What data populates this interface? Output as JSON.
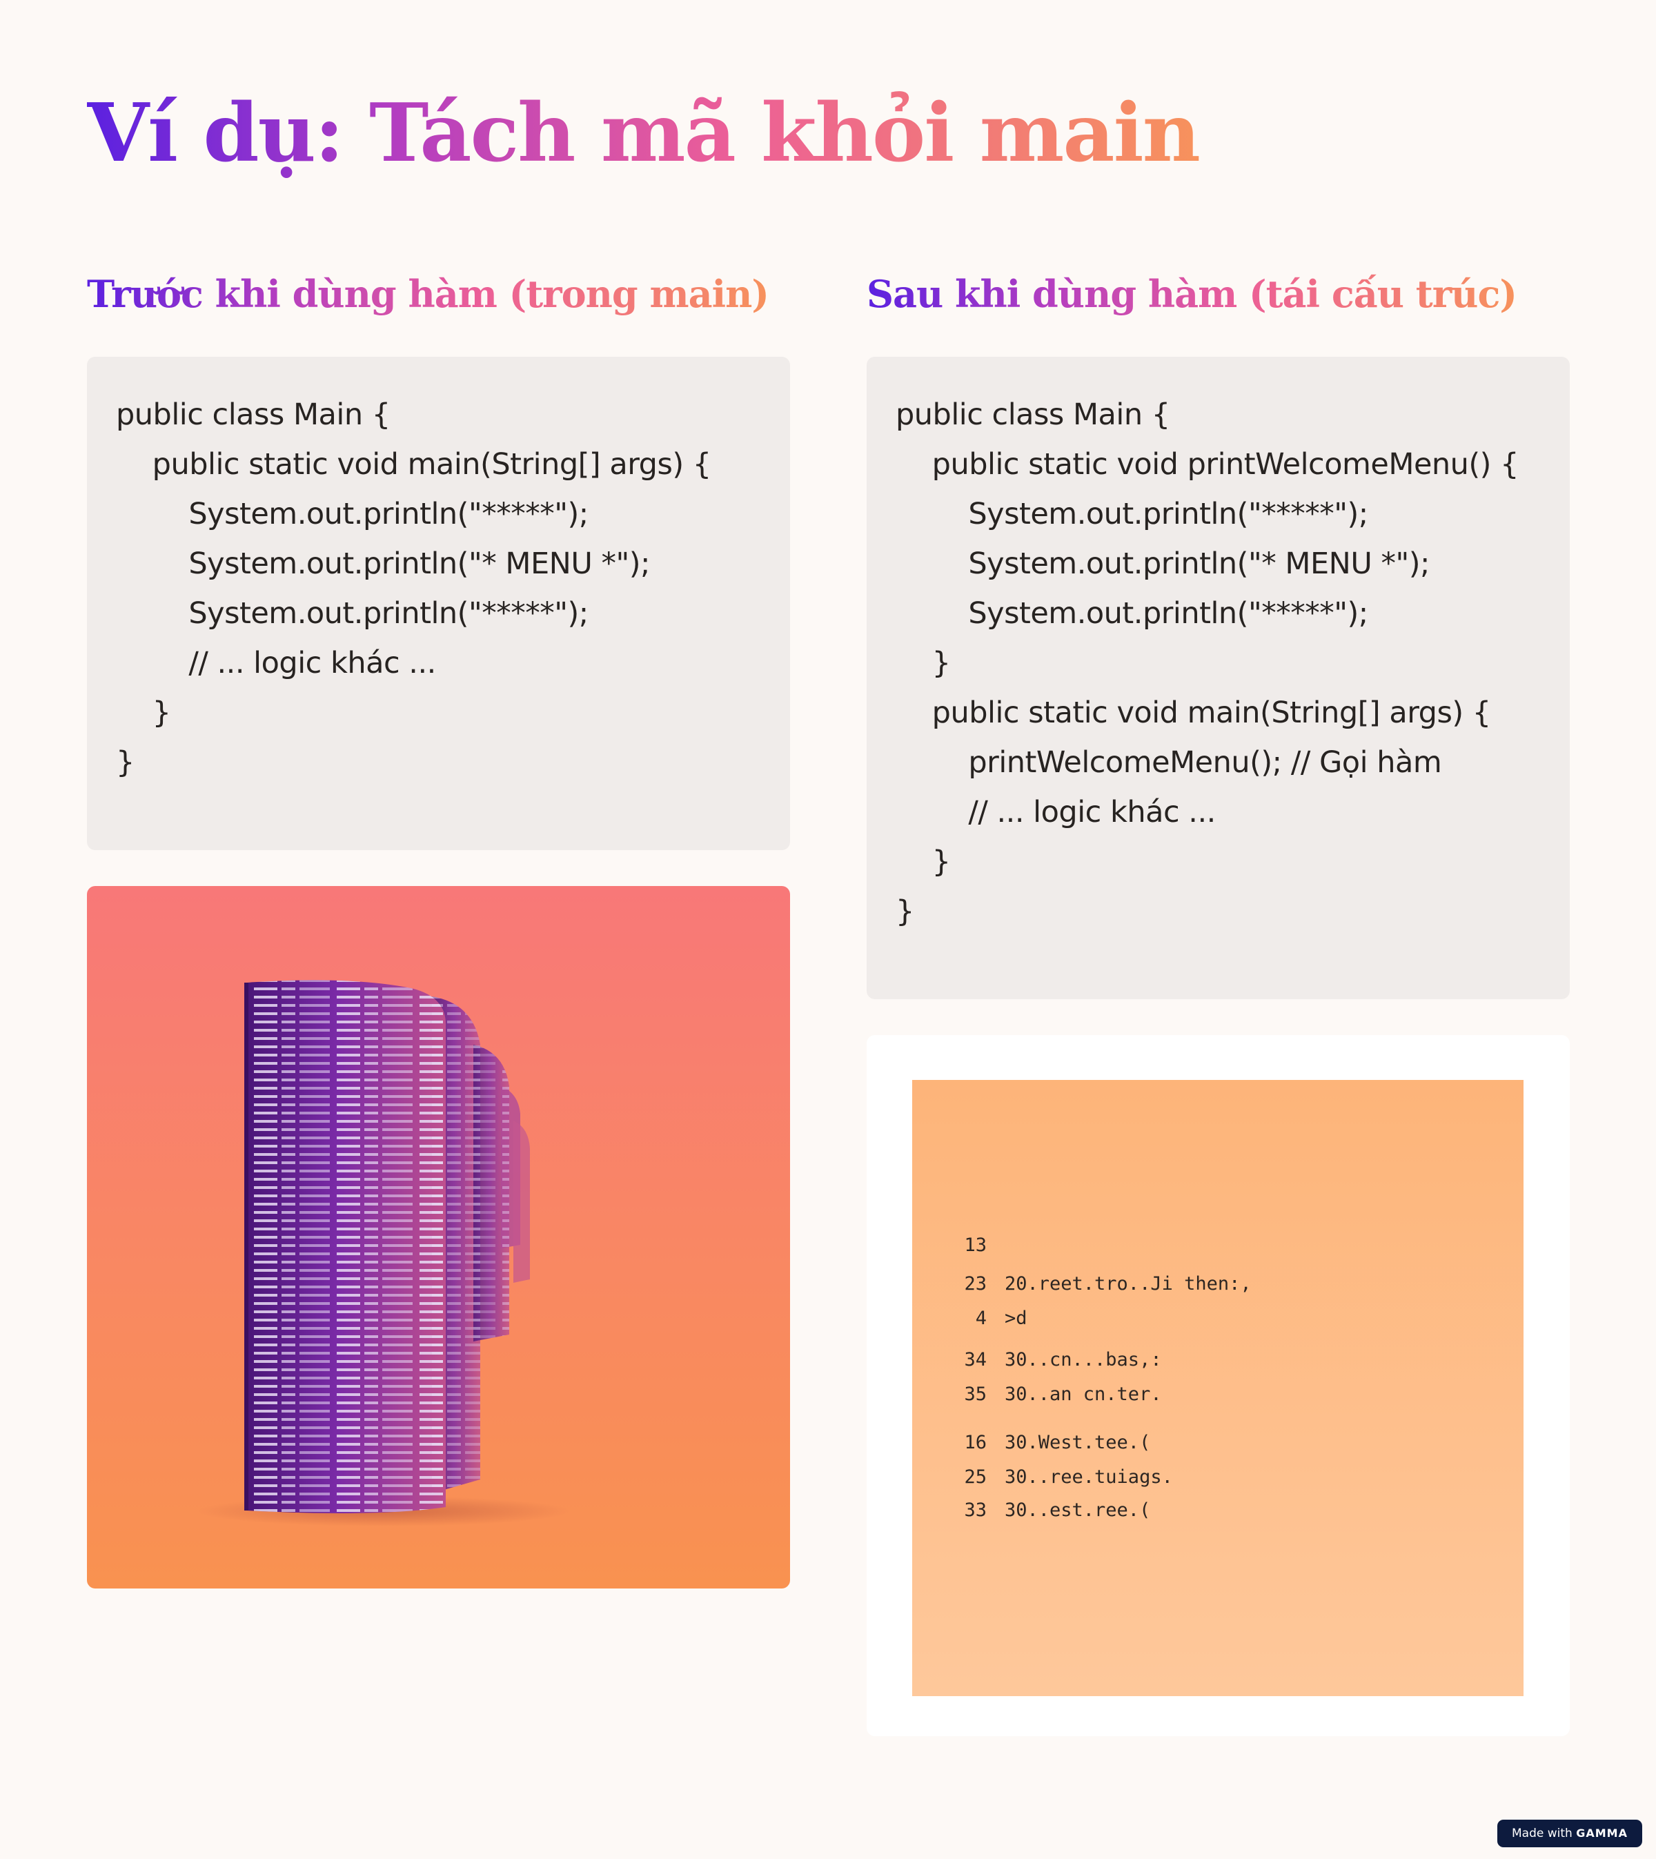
{
  "title": "Ví dụ: Tách mã khỏi main",
  "before": {
    "heading": "Trước khi dùng hàm (trong main)",
    "code": [
      "public class Main {",
      "    public static void main(String[] args) {",
      "        System.out.println(\"*****\");",
      "        System.out.println(\"* MENU *\");",
      "        System.out.println(\"*****\");",
      "        // ... logic khác ...",
      "    }",
      "}"
    ]
  },
  "after": {
    "heading": "Sau khi dùng hàm (tái cấu trúc)",
    "code": [
      "public class Main {",
      "    public static void printWelcomeMenu() {",
      "        System.out.println(\"*****\");",
      "        System.out.println(\"* MENU *\");",
      "        System.out.println(\"*****\");",
      "    }",
      "    public static void main(String[] args) {",
      "        printWelcomeMenu(); // Gọi hàm",
      "        // ... logic khác ...",
      "    }",
      "}"
    ]
  },
  "illustration_left": {
    "description_icon": "code-cylinder-illustration",
    "colors": {
      "bg_top": "#f87878",
      "bg_bottom": "#f99250",
      "cylinder": "#6a2a9a"
    }
  },
  "illustration_right": {
    "listing": [
      {
        "num": "13",
        "text": ""
      },
      {
        "num": "23",
        "text": "20.reet.tro..Ji then:,"
      },
      {
        "num": "4",
        "text": ">d"
      },
      {
        "num": "34",
        "text": "30..cn...bas,:"
      },
      {
        "num": "35",
        "text": "30..an cn.ter."
      },
      {
        "num": "16",
        "text": "30.West.tee.("
      },
      {
        "num": "25",
        "text": "30..ree.tuiags."
      },
      {
        "num": "33",
        "text": "30..est.ree.("
      }
    ]
  },
  "badge": {
    "prefix": "Made with",
    "brand": "GAMMA"
  }
}
